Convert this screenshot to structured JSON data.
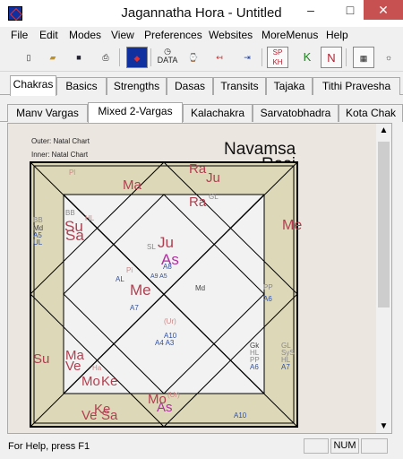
{
  "window": {
    "title": "Jagannatha Hora - Untitled",
    "minimize": "–",
    "maximize": "□",
    "close": "✕"
  },
  "menu": [
    "File",
    "Edit",
    "Modes",
    "View",
    "Preferences",
    "Websites",
    "MoreMenus",
    "Help"
  ],
  "toolbar": {
    "data": "DATA",
    "sp": "SP",
    "kh": "KH",
    "k": "K",
    "n": "N"
  },
  "tabs_top": [
    "Chakras",
    "Basics",
    "Strengths",
    "Dasas",
    "Transits",
    "Tajaka",
    "Tithi Pravesha"
  ],
  "tabs_top_selected": "Chakras",
  "tabs_sub": [
    "Manv Vargas",
    "Mixed 2-Vargas",
    "Kalachakra",
    "Sarvatobhadra",
    "Kota Chak"
  ],
  "tabs_sub_selected": "Mixed 2-Vargas",
  "chart": {
    "outer_label": "Outer: Natal Chart",
    "inner_label": "Inner: Natal Chart",
    "title1": "Navamsa",
    "title2": "Rasi",
    "labels": [
      {
        "t": "Pl",
        "c": "#c88"
      },
      {
        "t": "Ma",
        "c": "#b04050"
      },
      {
        "t": "Ra",
        "c": "#b04050"
      },
      {
        "t": "Ju",
        "c": "#b04050"
      },
      {
        "t": "Ra",
        "c": "#b04050"
      },
      {
        "t": "GL",
        "c": "#888"
      },
      {
        "t": "Me",
        "c": "#b04050"
      },
      {
        "t": "BB",
        "c": "#888"
      },
      {
        "t": "Md",
        "c": "#444"
      },
      {
        "t": "A5",
        "c": "#3050a0"
      },
      {
        "t": "UL",
        "c": "#3050a0"
      },
      {
        "t": "BB",
        "c": "#888"
      },
      {
        "t": "Su",
        "c": "#b04050"
      },
      {
        "t": "Sa",
        "c": "#b04050"
      },
      {
        "t": "HL",
        "c": "#c88"
      },
      {
        "t": "SL",
        "c": "#888"
      },
      {
        "t": "Ju",
        "c": "#b04050"
      },
      {
        "t": "As",
        "c": "#b030a0"
      },
      {
        "t": "A8",
        "c": "#3050a0"
      },
      {
        "t": "Pi",
        "c": "#c88"
      },
      {
        "t": "AL",
        "c": "#3050a0"
      },
      {
        "t": "A9 A5",
        "c": "#3050a0"
      },
      {
        "t": "Me",
        "c": "#b04050"
      },
      {
        "t": "Md",
        "c": "#444"
      },
      {
        "t": "PP",
        "c": "#888"
      },
      {
        "t": "A6",
        "c": "#3050a0"
      },
      {
        "t": "A7",
        "c": "#3050a0"
      },
      {
        "t": "(Ur)",
        "c": "#c88"
      },
      {
        "t": "A10",
        "c": "#3050a0"
      },
      {
        "t": "A4 A3",
        "c": "#3050a0"
      },
      {
        "t": "Gk",
        "c": "#444"
      },
      {
        "t": "HL",
        "c": "#888"
      },
      {
        "t": "PP",
        "c": "#888"
      },
      {
        "t": "A6",
        "c": "#3050a0"
      },
      {
        "t": "GL",
        "c": "#888"
      },
      {
        "t": "SyS",
        "c": "#888"
      },
      {
        "t": "HL",
        "c": "#888"
      },
      {
        "t": "A7",
        "c": "#3050a0"
      },
      {
        "t": "Su",
        "c": "#b04050"
      },
      {
        "t": "Ma",
        "c": "#b04050"
      },
      {
        "t": "Ve",
        "c": "#b04050"
      },
      {
        "t": "Ha",
        "c": "#c88"
      },
      {
        "t": "Mo",
        "c": "#b04050"
      },
      {
        "t": "Ke",
        "c": "#b04050"
      },
      {
        "t": "Mo",
        "c": "#b04050"
      },
      {
        "t": "(Ur)",
        "c": "#c88"
      },
      {
        "t": "As",
        "c": "#b030a0"
      },
      {
        "t": "Ke",
        "c": "#b04050"
      },
      {
        "t": "Ve",
        "c": "#b04050"
      },
      {
        "t": "Sa",
        "c": "#b04050"
      },
      {
        "t": "A10",
        "c": "#3050a0"
      }
    ]
  },
  "status": {
    "text": "For Help, press F1",
    "num": "NUM"
  },
  "colors": {
    "outer_fill": "#ddd8b8",
    "inner_fill": "#f2f2f2",
    "chart_bg": "#ece6e0"
  }
}
